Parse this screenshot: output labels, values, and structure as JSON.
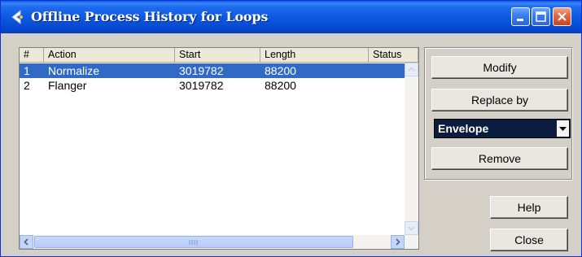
{
  "window": {
    "title": "Offline Process History for Loops"
  },
  "table": {
    "columns": [
      "#",
      "Action",
      "Start",
      "Length",
      "Status"
    ],
    "rows": [
      {
        "num": "1",
        "action": "Normalize",
        "start": "3019782",
        "length": "88200",
        "status": "",
        "selected": true
      },
      {
        "num": "2",
        "action": "Flanger",
        "start": "3019782",
        "length": "88200",
        "status": "",
        "selected": false
      }
    ]
  },
  "buttons": {
    "modify": "Modify",
    "replace_by": "Replace by",
    "remove": "Remove",
    "help": "Help",
    "close": "Close"
  },
  "replace_select": {
    "value": "Envelope"
  },
  "colors": {
    "titlebar": "#0a58e0",
    "selection": "#316ac5",
    "face": "#d4d0c8",
    "combo": "#0a1d3e"
  }
}
